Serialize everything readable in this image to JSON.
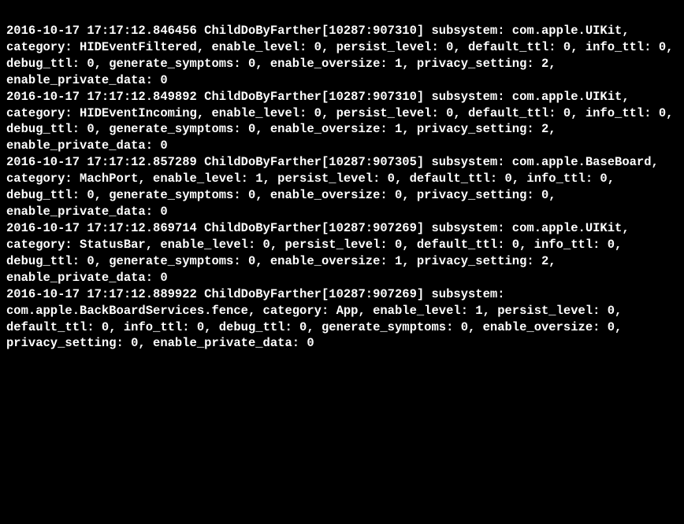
{
  "log": "2016-10-17 17:17:12.846456 ChildDoByFarther[10287:907310] subsystem: com.apple.UIKit, category: HIDEventFiltered, enable_level: 0, persist_level: 0, default_ttl: 0, info_ttl: 0, debug_ttl: 0, generate_symptoms: 0, enable_oversize: 1, privacy_setting: 2, enable_private_data: 0\n2016-10-17 17:17:12.849892 ChildDoByFarther[10287:907310] subsystem: com.apple.UIKit, category: HIDEventIncoming, enable_level: 0, persist_level: 0, default_ttl: 0, info_ttl: 0, debug_ttl: 0, generate_symptoms: 0, enable_oversize: 1, privacy_setting: 2, enable_private_data: 0\n2016-10-17 17:17:12.857289 ChildDoByFarther[10287:907305] subsystem: com.apple.BaseBoard, category: MachPort, enable_level: 1, persist_level: 0, default_ttl: 0, info_ttl: 0, debug_ttl: 0, generate_symptoms: 0, enable_oversize: 0, privacy_setting: 0, enable_private_data: 0\n2016-10-17 17:17:12.869714 ChildDoByFarther[10287:907269] subsystem: com.apple.UIKit, category: StatusBar, enable_level: 0, persist_level: 0, default_ttl: 0, info_ttl: 0, debug_ttl: 0, generate_symptoms: 0, enable_oversize: 1, privacy_setting: 2, enable_private_data: 0\n2016-10-17 17:17:12.889922 ChildDoByFarther[10287:907269] subsystem: com.apple.BackBoardServices.fence, category: App, enable_level: 1, persist_level: 0, default_ttl: 0, info_ttl: 0, debug_ttl: 0, generate_symptoms: 0, enable_oversize: 0, privacy_setting: 0, enable_private_data: 0"
}
